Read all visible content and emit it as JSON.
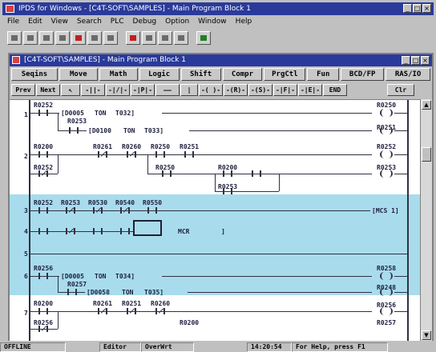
{
  "app": {
    "title": "IPDS for Windows - [C4T-SOFT\\SAMPLES] - Main Program Block 1",
    "window_buttons": [
      "_",
      "□",
      "×"
    ]
  },
  "menu": [
    "File",
    "Edit",
    "View",
    "Search",
    "PLC",
    "Debug",
    "Option",
    "Window",
    "Help"
  ],
  "toolbar_icons": [
    "new-icon",
    "open-icon",
    "save-icon",
    "print-icon",
    "cut-icon",
    "copy-icon",
    "paste-icon",
    "run-icon",
    "stop-icon",
    "monitor-icon",
    "info-icon",
    "help-icon"
  ],
  "inner_window": {
    "title": "[C4T-SOFT\\SAMPLES] - Main Program Block 1",
    "window_buttons": [
      "_",
      "□",
      "×"
    ]
  },
  "function_buttons": [
    "Seqins",
    "Move",
    "Math",
    "Logic",
    "Shift",
    "Compr",
    "PrgCtl",
    "Fun",
    "BCD/FP",
    "RAS/IO"
  ],
  "symbol_buttons": [
    "Prev",
    "Next",
    "↖",
    "-||-",
    "-|/|-",
    "-|P|-",
    "——",
    "|",
    "-( )-",
    "-(R)-",
    "-(S)-",
    "-|F|-",
    "-|E|-",
    "END",
    "Clr"
  ],
  "ladder": {
    "rungs": [
      {
        "number": "1",
        "labels": [
          "R0252",
          "R0250",
          "[D0005",
          "TON",
          "T032]",
          "R0253",
          "R0251",
          "[D0100",
          "TON",
          "T033]"
        ]
      },
      {
        "number": "2",
        "labels": [
          "R0200",
          "R0261",
          "R0260",
          "R0250",
          "R0251",
          "R0252",
          "R0252",
          "R0250",
          "R0200",
          "R0253",
          "R0253"
        ]
      },
      {
        "number": "3",
        "labels": [
          "R0252",
          "R0253",
          "R0530",
          "R0540",
          "R0550",
          "[MCS 1]"
        ]
      },
      {
        "number": "4",
        "labels": [
          "MCR",
          "]"
        ]
      },
      {
        "number": "5",
        "labels": []
      },
      {
        "number": "6",
        "labels": [
          "R0256",
          "R0258",
          "[D0005",
          "TON",
          "T034]",
          "R0257",
          "R0248",
          "[D0058",
          "TON",
          "T035]"
        ]
      },
      {
        "number": "7",
        "labels": [
          "R0200",
          "R0261",
          "R0251",
          "R0260",
          "R0256",
          "R0256",
          "R0200",
          "R0257"
        ]
      }
    ]
  },
  "status": {
    "mode": "OFFLINE",
    "editor": "Editor",
    "overwrite": "OverWrt",
    "time": "14:20:54",
    "help": "For Help, press F1"
  }
}
